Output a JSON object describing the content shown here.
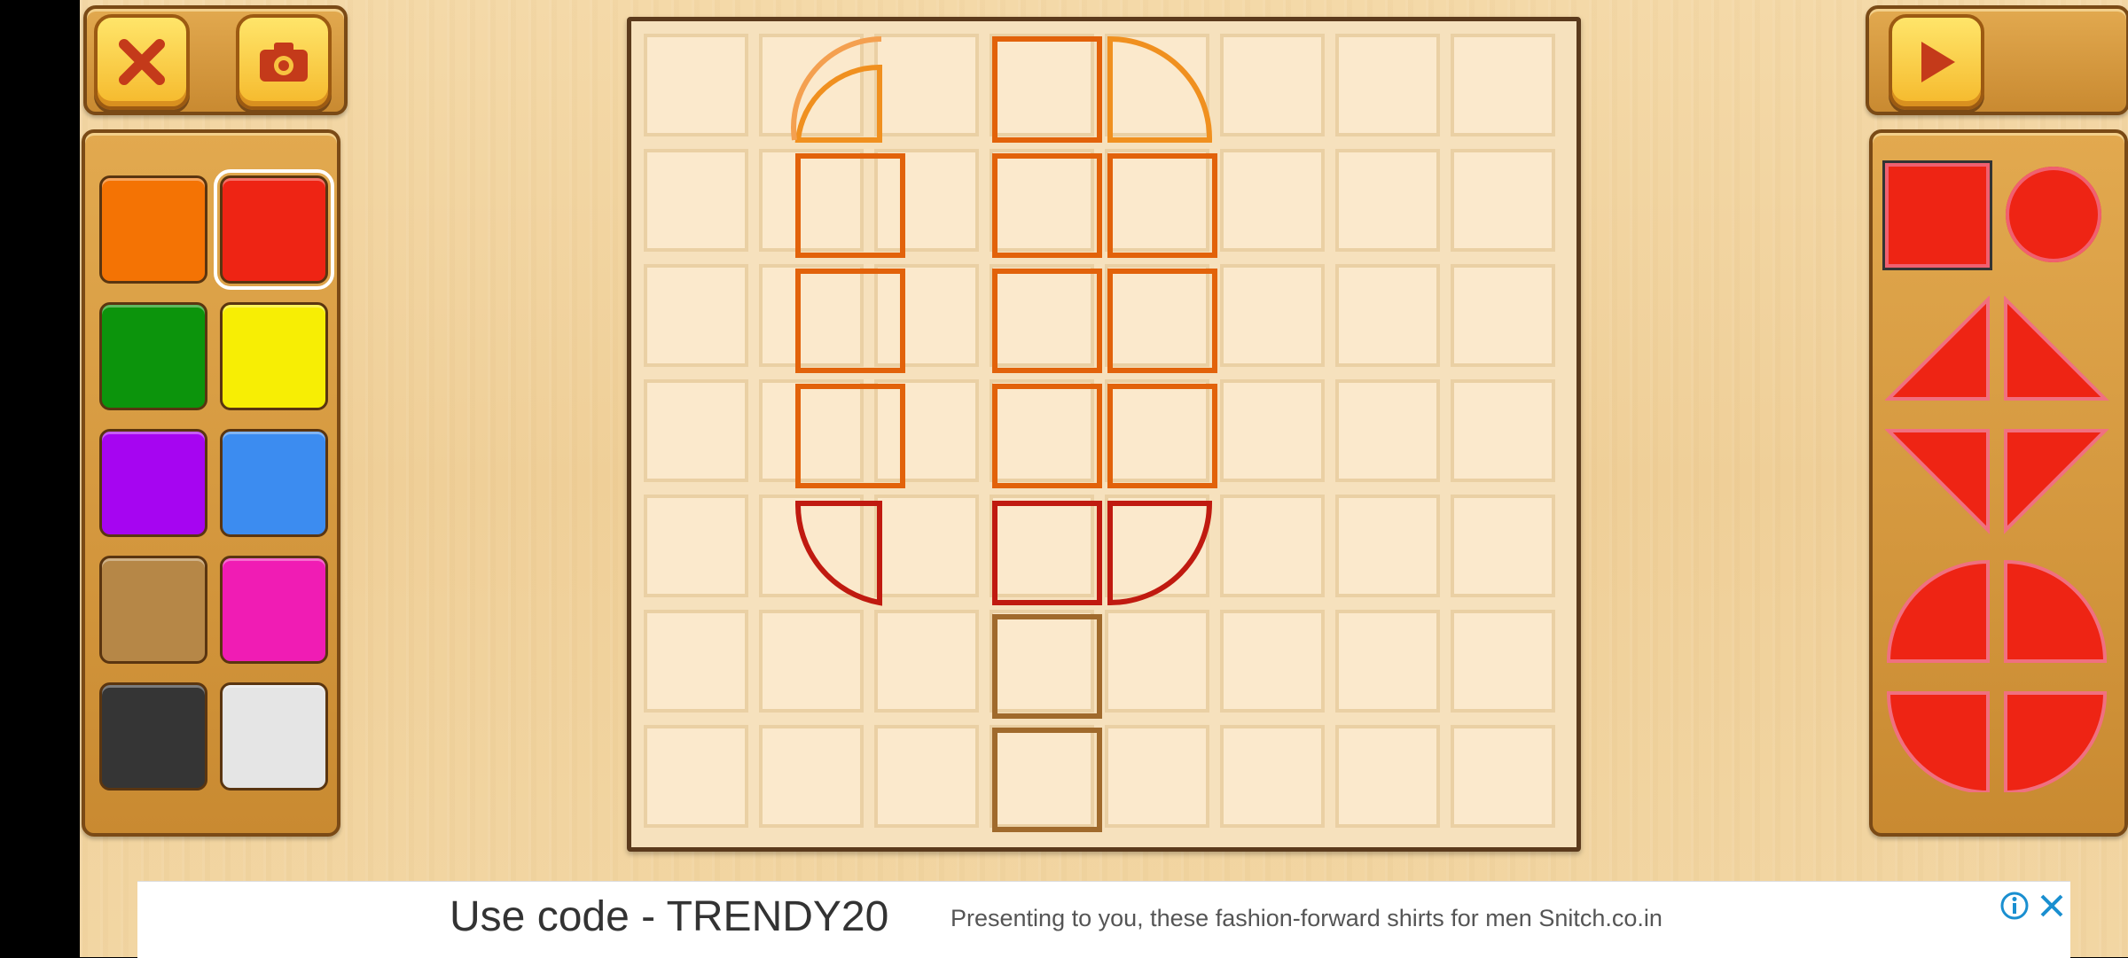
{
  "toolbar": {
    "close_icon": "close-icon",
    "camera_icon": "camera-icon",
    "play_icon": "play-icon"
  },
  "colors": [
    {
      "name": "orange",
      "hex": "#f47304"
    },
    {
      "name": "red",
      "hex": "#ee2414",
      "selected": true
    },
    {
      "name": "green",
      "hex": "#0c940c"
    },
    {
      "name": "yellow",
      "hex": "#f7ee04"
    },
    {
      "name": "purple",
      "hex": "#a605f1"
    },
    {
      "name": "blue",
      "hex": "#3c8cf0"
    },
    {
      "name": "brown",
      "hex": "#b68747"
    },
    {
      "name": "pink",
      "hex": "#f01cb4"
    },
    {
      "name": "black",
      "hex": "#353535"
    },
    {
      "name": "white",
      "hex": "#e5e5e5"
    }
  ],
  "shapes": [
    "square",
    "circle",
    "triangle-bottom-right",
    "triangle-bottom-left",
    "triangle-top-right",
    "triangle-top-left",
    "quarter-circle-top-left",
    "quarter-circle-top-right",
    "quarter-circle-bottom-left",
    "quarter-circle-bottom-right"
  ],
  "selected_shape": "square",
  "selected_color_hex": "#ee2414",
  "board": {
    "columns": 8,
    "rows": 7,
    "outline_colors": {
      "top": "#f0801a",
      "middle": "#e2620a",
      "bottom": "#c01a10",
      "stick": "#a06a2c"
    }
  },
  "ad": {
    "code_text": "Use code - TRENDY20",
    "body_text": "Presenting to you, these fashion-forward shirts for men Snitch.co.in",
    "info_icon": "info-icon",
    "close_icon": "ad-close-icon"
  }
}
